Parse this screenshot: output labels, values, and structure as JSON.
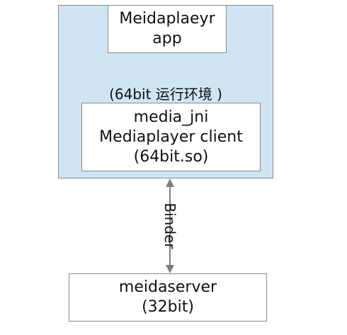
{
  "diagram": {
    "process_box": {
      "env_label": "(64bit 运行环境 )"
    },
    "app": {
      "line1": "Meidaplaeyr",
      "line2": "app"
    },
    "jni": {
      "line1": "media_jni",
      "line2": "Mediaplayer client",
      "line3": "(64bit.so)"
    },
    "server": {
      "line1": "meidaserver",
      "line2": "(32bit)"
    },
    "connector": {
      "label": "Binder"
    },
    "colors": {
      "process_fill": "#cfe5f4",
      "border": "#8a8a8a",
      "arrow": "#808080"
    }
  }
}
